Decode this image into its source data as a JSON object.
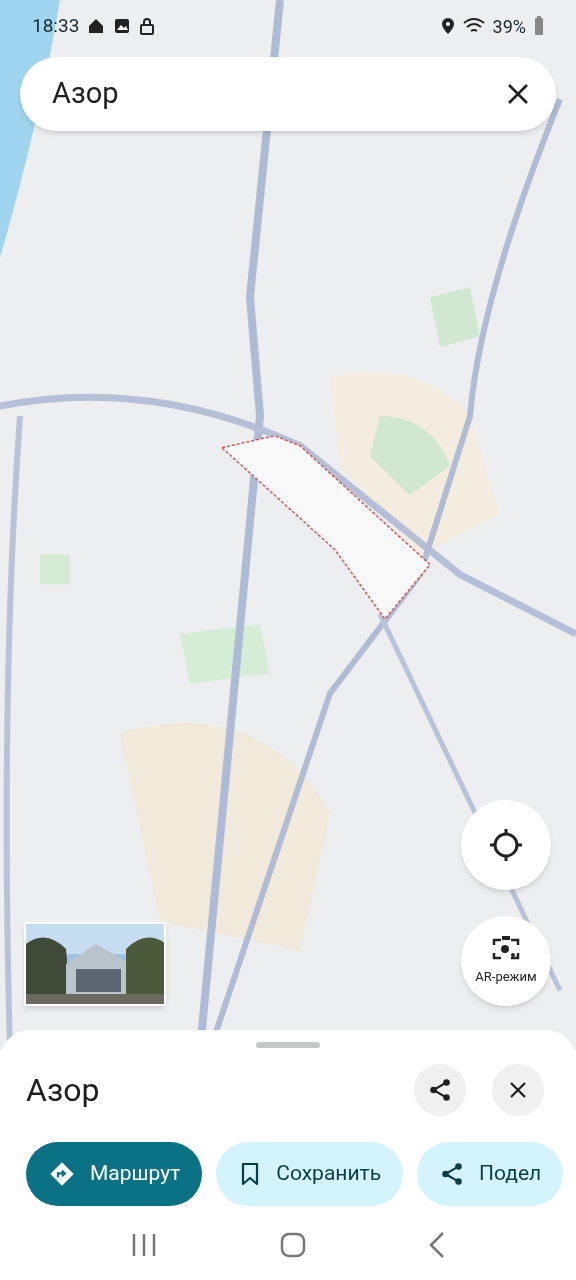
{
  "status_bar": {
    "time": "18:33",
    "battery": "39%"
  },
  "search": {
    "value": "Азор"
  },
  "ar_button": {
    "label": "AR-режим"
  },
  "place_sheet": {
    "title": "Азор",
    "actions": [
      {
        "kind": "directions",
        "label": "Маршрут",
        "primary": true
      },
      {
        "kind": "save",
        "label": "Сохранить",
        "primary": false
      },
      {
        "kind": "share",
        "label": "Подел",
        "primary": false
      }
    ]
  }
}
